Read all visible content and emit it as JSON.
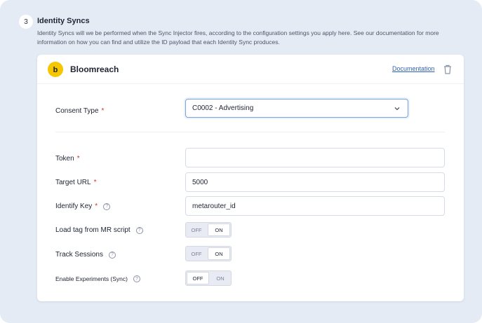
{
  "section": {
    "step": "3",
    "title": "Identity Syncs",
    "description": "Identity Syncs will we be performed when the Sync Injector fires, according to the configuration settings you apply here. See our documentation for more information on how you can find and utilize the ID payload that each Identity Sync produces."
  },
  "card": {
    "name": "Bloomreach",
    "documentation_link": "Documentation",
    "logo_color": "#f6c600"
  },
  "form": {
    "consent_type": {
      "label": "Consent Type",
      "required": "*",
      "value": "C0002 - Advertising"
    },
    "token": {
      "label": "Token",
      "required": "*",
      "value": ""
    },
    "target_url": {
      "label": "Target URL",
      "required": "*",
      "value": "5000"
    },
    "identify_key": {
      "label": "Identify Key",
      "required": "*",
      "value": "metarouter_id"
    },
    "load_tag": {
      "label": "Load tag from MR script",
      "off": "OFF",
      "on": "ON",
      "state": "ON"
    },
    "track_sessions": {
      "label": "Track Sessions",
      "off": "OFF",
      "on": "ON",
      "state": "ON"
    },
    "enable_experiments": {
      "label": "Enable Experiments (Sync)",
      "off": "OFF",
      "on": "ON",
      "state": "OFF"
    }
  },
  "icons": {
    "help": "?",
    "trash": "trash-icon",
    "chevron": "chevron-down-icon",
    "logo": "bloomreach-logo-icon"
  },
  "colors": {
    "background": "#e4ebf5",
    "link": "#2f5fb8",
    "required": "#d0342c",
    "focus_border": "#7aa2de"
  }
}
